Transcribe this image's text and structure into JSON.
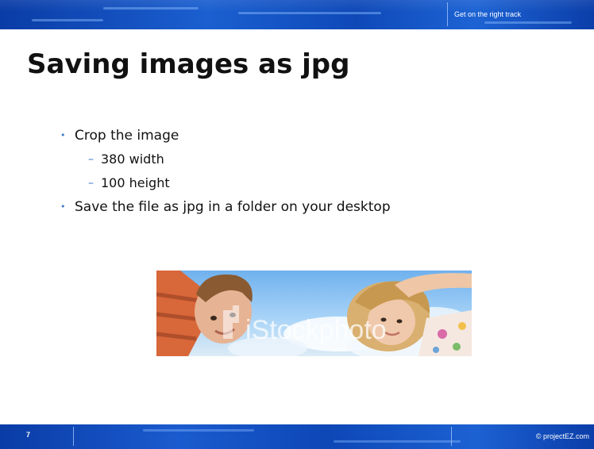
{
  "header": {
    "tagline": "Get on the right track"
  },
  "slide": {
    "title": "Saving images as jpg",
    "bullets": [
      {
        "text": "Crop the image"
      },
      {
        "text": "380 width"
      },
      {
        "text": "100 height"
      },
      {
        "text": "Save the file as jpg in a folder on your desktop"
      }
    ],
    "image": {
      "watermark": "iStockphoto"
    }
  },
  "footer": {
    "page_number": "7",
    "copyright": "© projectEZ.com"
  }
}
